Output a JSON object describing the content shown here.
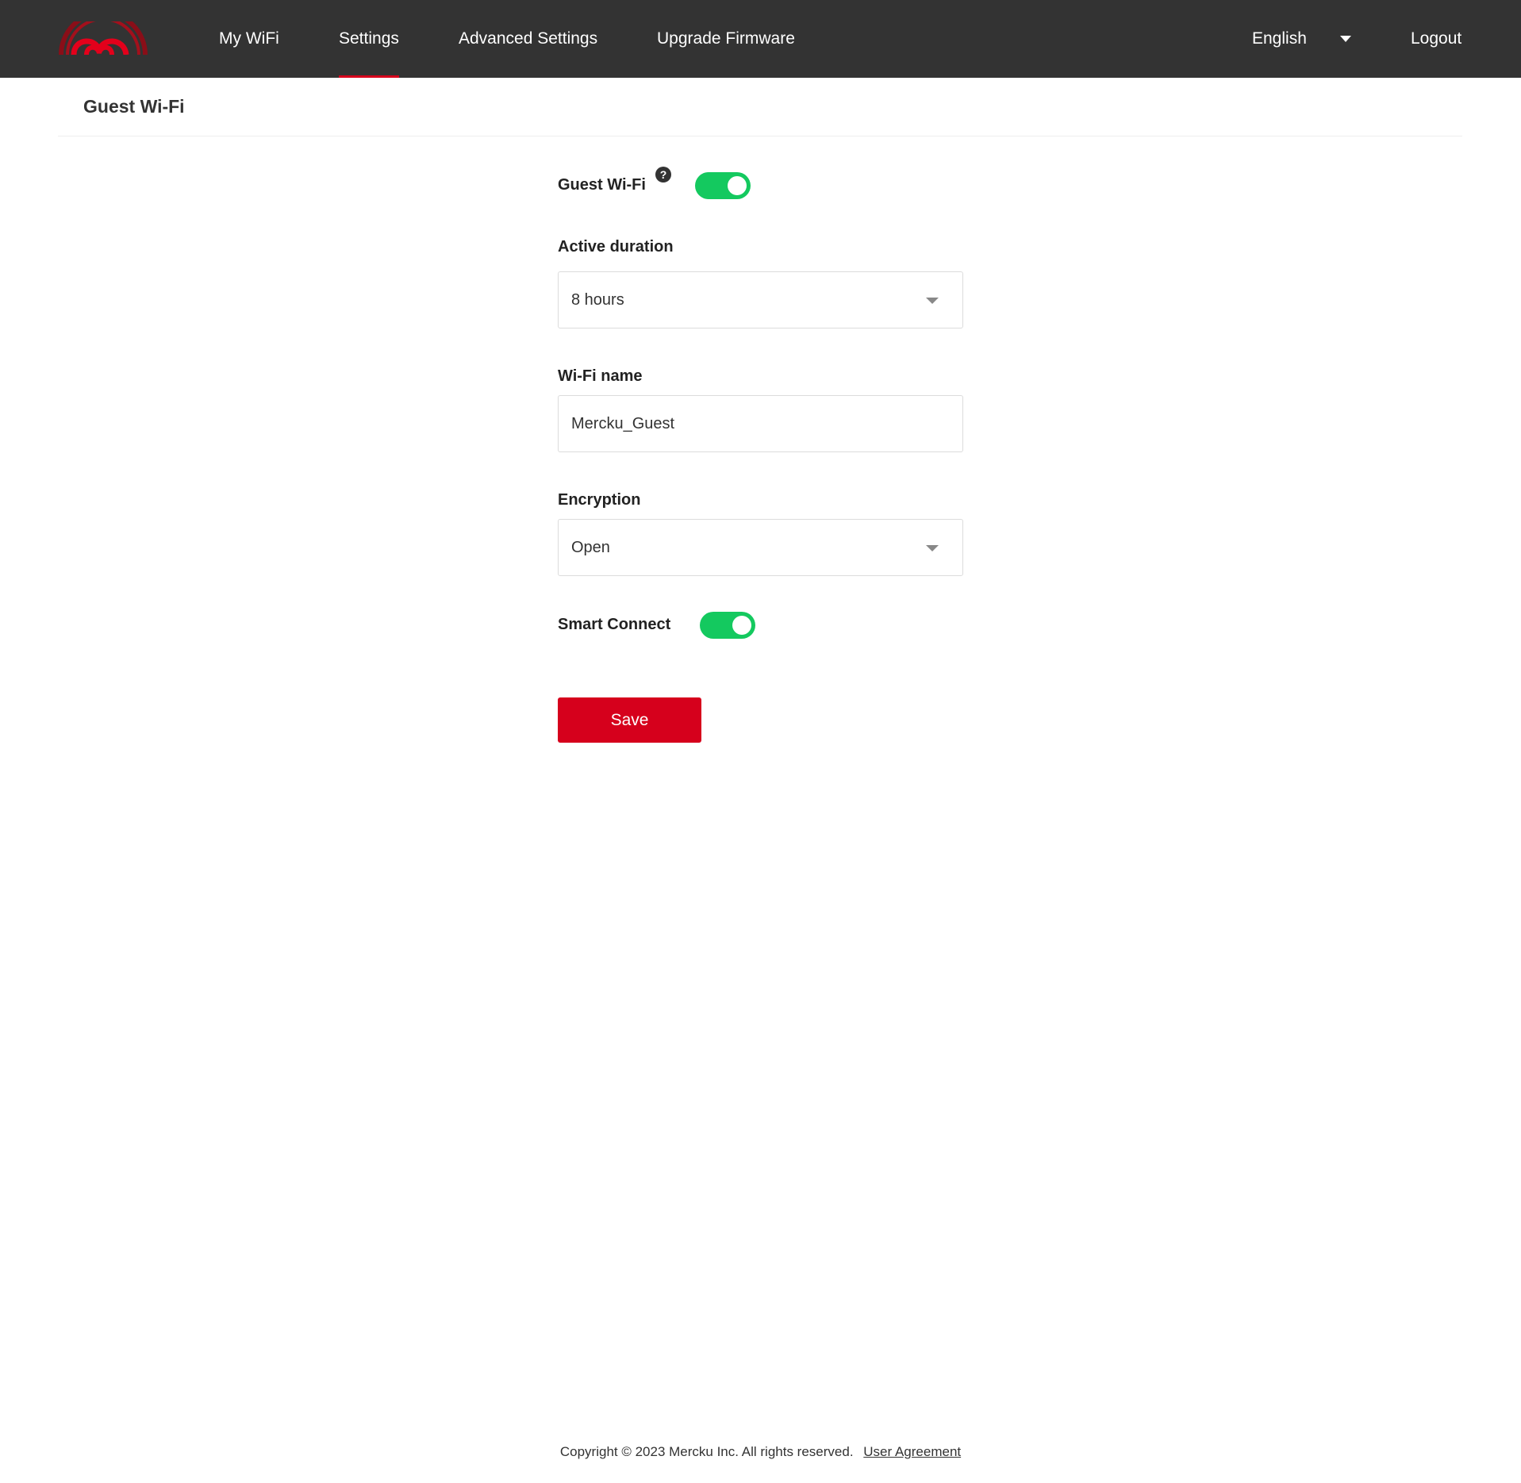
{
  "header": {
    "logo": "mercku-logo",
    "nav": [
      {
        "label": "My WiFi",
        "active": false
      },
      {
        "label": "Settings",
        "active": true
      },
      {
        "label": "Advanced Settings",
        "active": false
      },
      {
        "label": "Upgrade Firmware",
        "active": false
      }
    ],
    "language": "English",
    "logout_label": "Logout"
  },
  "page": {
    "title": "Guest Wi-Fi"
  },
  "form": {
    "guest_wifi_label": "Guest Wi-Fi",
    "guest_wifi_help": "?",
    "guest_wifi_enabled": true,
    "active_duration_label": "Active duration",
    "active_duration_value": "8 hours",
    "wifi_name_label": "Wi-Fi name",
    "wifi_name_value": "Mercku_Guest",
    "encryption_label": "Encryption",
    "encryption_value": "Open",
    "smart_connect_label": "Smart Connect",
    "smart_connect_enabled": true,
    "save_label": "Save"
  },
  "footer": {
    "copyright": "Copyright © 2023 Mercku Inc. All rights reserved.",
    "user_agreement": "User Agreement"
  },
  "colors": {
    "header_bg": "#333333",
    "accent": "#d6001c",
    "toggle_on": "#14c95f"
  }
}
